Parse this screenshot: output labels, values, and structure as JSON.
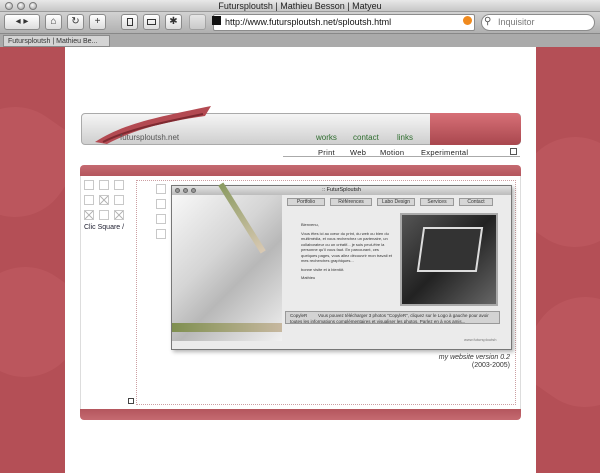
{
  "window": {
    "title": "Futursploutsh | Mathieu Besson | Matyeu"
  },
  "toolbar": {
    "back_fwd": "◂ ▸",
    "home": "⌂",
    "reload": "↻",
    "add": "+",
    "url": "http://www.futursploutsh.net/sploutsh.html",
    "search_placeholder": "Inquisitor"
  },
  "tab": {
    "label": "Futursploutsh | Mathieu Be..."
  },
  "site": {
    "logo_text": "futursploutsh.net",
    "top_links": [
      "works",
      "contact",
      "links"
    ],
    "sub_nav": [
      "Print",
      "Web",
      "Motion",
      "Experimental"
    ],
    "clic_label": "Clic Square /",
    "version_label": "my website version 0.2",
    "version_years": "(2003-2005)"
  },
  "inner": {
    "title": ":: FuturSploutsh",
    "nav": [
      "Portfolio",
      "Références",
      "Labo Design",
      "Services",
      "Contact"
    ],
    "welcome": "Bienvenu,",
    "body": "Vous êtes ici au cœur du print, du web ou bien du multimédia, et vous recherchez un partenaire, un collaborateur ou un créatif... je suis peut-être la personne qu'il vous faut. En parcourant, ces quelques pages, vous allez découvrir mon travail et mes recherches graphiques...",
    "signoff": "bonne visite et à bientôt.",
    "name": "Mathieu",
    "copyleft_label": "CopyleR",
    "copyleft_text": "Vous pouvez télécharger 3 photos \"CopyleR\", cliquez sur le Logo à gauche pour avoir toutes les informations complémentaires et visualiser les photos. Parlez en à vos amis...",
    "footer": "www.futursploutsh"
  },
  "colors": {
    "brand_red": "#b44f56",
    "link_green": "#2f6e2f"
  }
}
